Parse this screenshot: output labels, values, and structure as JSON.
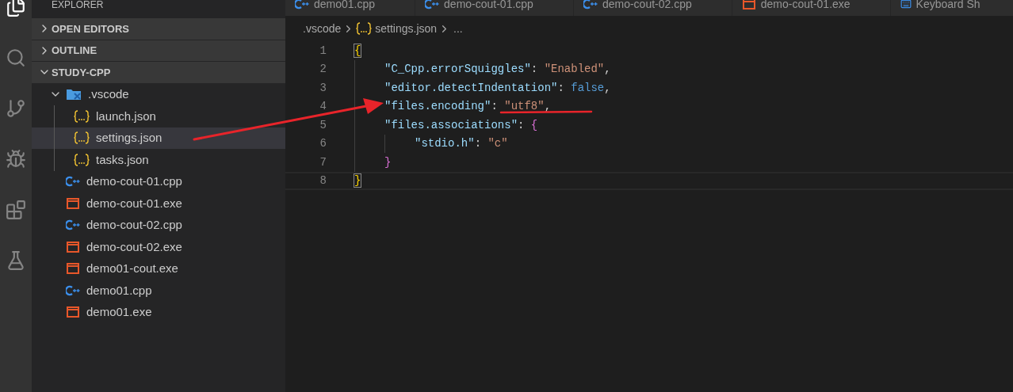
{
  "sidebar": {
    "title": "EXPLORER",
    "sections": [
      {
        "label": "OPEN EDITORS",
        "expanded": false
      },
      {
        "label": "OUTLINE",
        "expanded": false
      },
      {
        "label": "STUDY-CPP",
        "expanded": true,
        "items": [
          {
            "name": ".vscode",
            "kind": "vscode-folder",
            "expanded": true,
            "selected": false,
            "children": [
              {
                "name": "launch.json",
                "kind": "json",
                "selected": false
              },
              {
                "name": "settings.json",
                "kind": "json",
                "selected": true
              },
              {
                "name": "tasks.json",
                "kind": "json",
                "selected": false
              }
            ]
          },
          {
            "name": "demo-cout-01.cpp",
            "kind": "cpp",
            "selected": false
          },
          {
            "name": "demo-cout-01.exe",
            "kind": "exe",
            "selected": false
          },
          {
            "name": "demo-cout-02.cpp",
            "kind": "cpp",
            "selected": false
          },
          {
            "name": "demo-cout-02.exe",
            "kind": "exe",
            "selected": false
          },
          {
            "name": "demo01-cout.exe",
            "kind": "exe",
            "selected": false
          },
          {
            "name": "demo01.cpp",
            "kind": "cpp",
            "selected": false
          },
          {
            "name": "demo01.exe",
            "kind": "exe",
            "selected": false
          }
        ]
      }
    ]
  },
  "tabs": [
    {
      "label": "demo01.cpp",
      "kind": "cpp"
    },
    {
      "label": "demo-cout-01.cpp",
      "kind": "cpp"
    },
    {
      "label": "demo-cout-02.cpp",
      "kind": "cpp"
    },
    {
      "label": "demo-cout-01.exe",
      "kind": "exe"
    },
    {
      "label": "Keyboard Sh",
      "kind": "keyboard"
    }
  ],
  "breadcrumbs": [
    {
      "label": ".vscode",
      "kind": "folder"
    },
    {
      "label": "settings.json",
      "kind": "json"
    },
    {
      "label": "...",
      "kind": "more"
    }
  ],
  "editor": {
    "lines": [
      {
        "number": "1",
        "tokens": [
          {
            "text": "{",
            "kind": "bracket-1"
          }
        ],
        "children": [
          {
            "number": "2",
            "tokens": [
              {
                "text": "\"C_Cpp.errorSquiggles\"",
                "kind": "key"
              },
              {
                "text": ": ",
                "kind": "punct"
              },
              {
                "text": "\"Enabled\"",
                "kind": "string"
              },
              {
                "text": ",",
                "kind": "punct"
              }
            ]
          },
          {
            "number": "3",
            "tokens": [
              {
                "text": "\"editor.detectIndentation\"",
                "kind": "key"
              },
              {
                "text": ": ",
                "kind": "punct"
              },
              {
                "text": "false",
                "kind": "bool"
              },
              {
                "text": ",",
                "kind": "punct"
              }
            ]
          },
          {
            "number": "4",
            "tokens": [
              {
                "text": "\"files.encoding\"",
                "kind": "key"
              },
              {
                "text": ": ",
                "kind": "punct"
              },
              {
                "text": "\"utf8\"",
                "kind": "string"
              },
              {
                "text": ",",
                "kind": "punct"
              }
            ]
          },
          {
            "number": "5",
            "tokens": [
              {
                "text": "\"files.associations\"",
                "kind": "key"
              },
              {
                "text": ": ",
                "kind": "punct"
              },
              {
                "text": "{",
                "kind": "bracket-2"
              }
            ],
            "children": [
              {
                "number": "6",
                "tokens": [
                  {
                    "text": "\"stdio.h\"",
                    "kind": "key"
                  },
                  {
                    "text": ": ",
                    "kind": "punct"
                  },
                  {
                    "text": "\"c\"",
                    "kind": "string"
                  }
                ]
              }
            ]
          },
          {
            "number": "7",
            "tokens": [
              {
                "text": "}",
                "kind": "bracket-2"
              }
            ]
          }
        ]
      },
      {
        "number": "8",
        "current": true,
        "tokens": [
          {
            "text": "}",
            "kind": "bracket-1"
          }
        ]
      }
    ]
  }
}
